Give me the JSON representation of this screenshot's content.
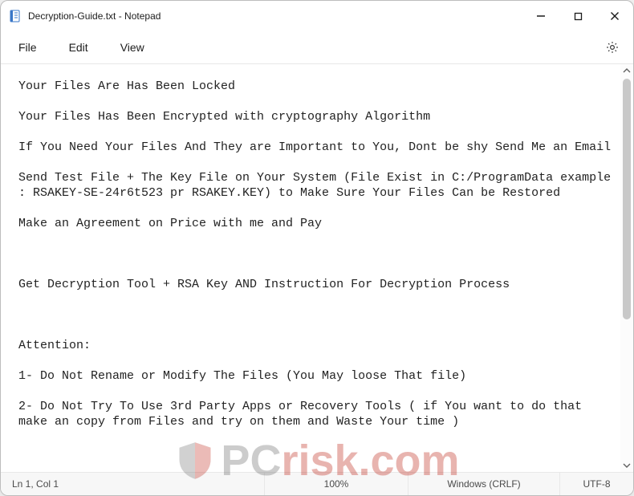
{
  "window": {
    "title": "Decryption-Guide.txt - Notepad"
  },
  "menu": {
    "file": "File",
    "edit": "Edit",
    "view": "View"
  },
  "document": {
    "lines": [
      "Your Files Are Has Been Locked",
      "",
      "Your Files Has Been Encrypted with cryptography Algorithm",
      "",
      "If You Need Your Files And They are Important to You, Dont be shy Send Me an Email",
      "",
      "Send Test File + The Key File on Your System (File Exist in C:/ProgramData example : RSAKEY-SE-24r6t523 pr RSAKEY.KEY) to Make Sure Your Files Can be Restored",
      "",
      "Make an Agreement on Price with me and Pay",
      "",
      "",
      "",
      "Get Decryption Tool + RSA Key AND Instruction For Decryption Process",
      "",
      "",
      "",
      "Attention:",
      "",
      "1- Do Not Rename or Modify The Files (You May loose That file)",
      "",
      "2- Do Not Try To Use 3rd Party Apps or Recovery Tools ( if You want to do that make an copy from Files and try on them and Waste Your time )"
    ]
  },
  "status": {
    "position": "Ln 1, Col 1",
    "zoom": "100%",
    "eol": "Windows (CRLF)",
    "encoding": "UTF-8"
  },
  "watermark": {
    "part_a": "PC",
    "part_b": "risk.com"
  }
}
